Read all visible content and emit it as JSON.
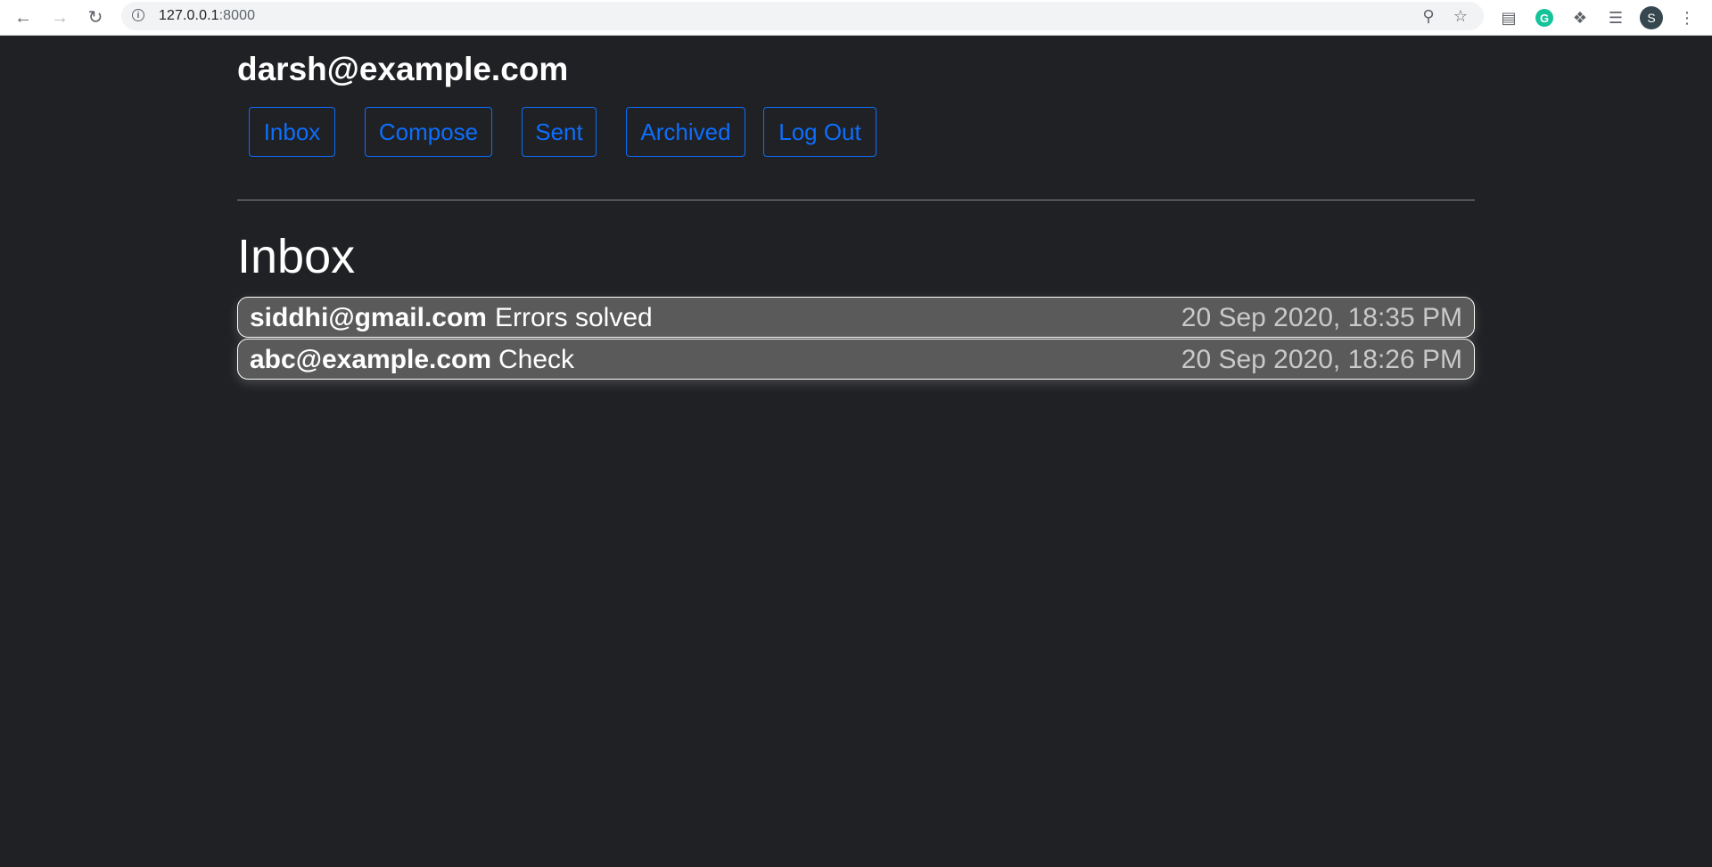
{
  "browser": {
    "url_host": "127.0.0.1",
    "url_port": ":8000",
    "profile_initial": "S",
    "grammarly_initial": "G"
  },
  "user": {
    "email": "darsh@example.com"
  },
  "nav": {
    "inbox": "Inbox",
    "compose": "Compose",
    "sent": "Sent",
    "archived": "Archived",
    "logout": "Log Out"
  },
  "page": {
    "title": "Inbox"
  },
  "emails": [
    {
      "sender": "siddhi@gmail.com",
      "subject": "Errors solved",
      "timestamp": "20 Sep 2020, 18:35 PM"
    },
    {
      "sender": "abc@example.com",
      "subject": "Check",
      "timestamp": "20 Sep 2020, 18:26 PM"
    }
  ],
  "colors": {
    "background": "#202124",
    "accent": "#0d6efd",
    "row_background": "#5a5a5a"
  }
}
